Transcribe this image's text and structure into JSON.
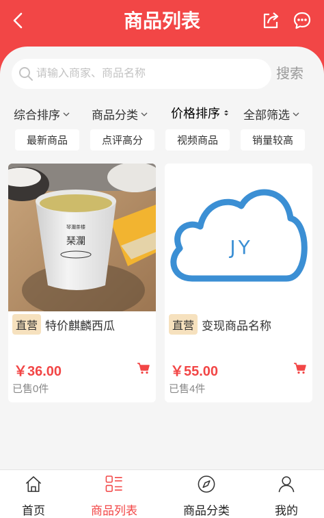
{
  "header": {
    "title": "商品列表",
    "back_icon": "chevron-left-icon",
    "share_icon": "share-icon",
    "chat_icon": "chat-icon",
    "bg_color": "#f24646"
  },
  "search": {
    "placeholder": "请输入商家、商品名称",
    "value": "",
    "button_label": "搜索"
  },
  "sort": {
    "items": [
      {
        "label": "综合排序",
        "icon": "chevron-down-icon"
      },
      {
        "label": "商品分类",
        "icon": "chevron-down-icon"
      },
      {
        "label": "价格排序",
        "icon": "sort-icon"
      },
      {
        "label": "全部筛选",
        "icon": "chevron-down-icon"
      }
    ]
  },
  "tags": [
    "最新商品",
    "点评高分",
    "视频商品",
    "销量较高"
  ],
  "products": [
    {
      "badge": "直营",
      "name": "特价麒麟西瓜",
      "price": "￥36.00",
      "sold": "已售0件",
      "image": "tea-cup-photo"
    },
    {
      "badge": "直营",
      "name": "变现商品名称",
      "price": "￥55.00",
      "sold": "已售4件",
      "image": "jy-cloud-logo",
      "logo_text": "JY"
    }
  ],
  "bottom_nav": {
    "items": [
      {
        "label": "首页",
        "icon": "home-icon",
        "active": false
      },
      {
        "label": "商品列表",
        "icon": "list-icon",
        "active": true
      },
      {
        "label": "商品分类",
        "icon": "compass-icon",
        "active": false
      },
      {
        "label": "我的",
        "icon": "user-icon",
        "active": false
      }
    ]
  },
  "accent_color": "#f24646"
}
